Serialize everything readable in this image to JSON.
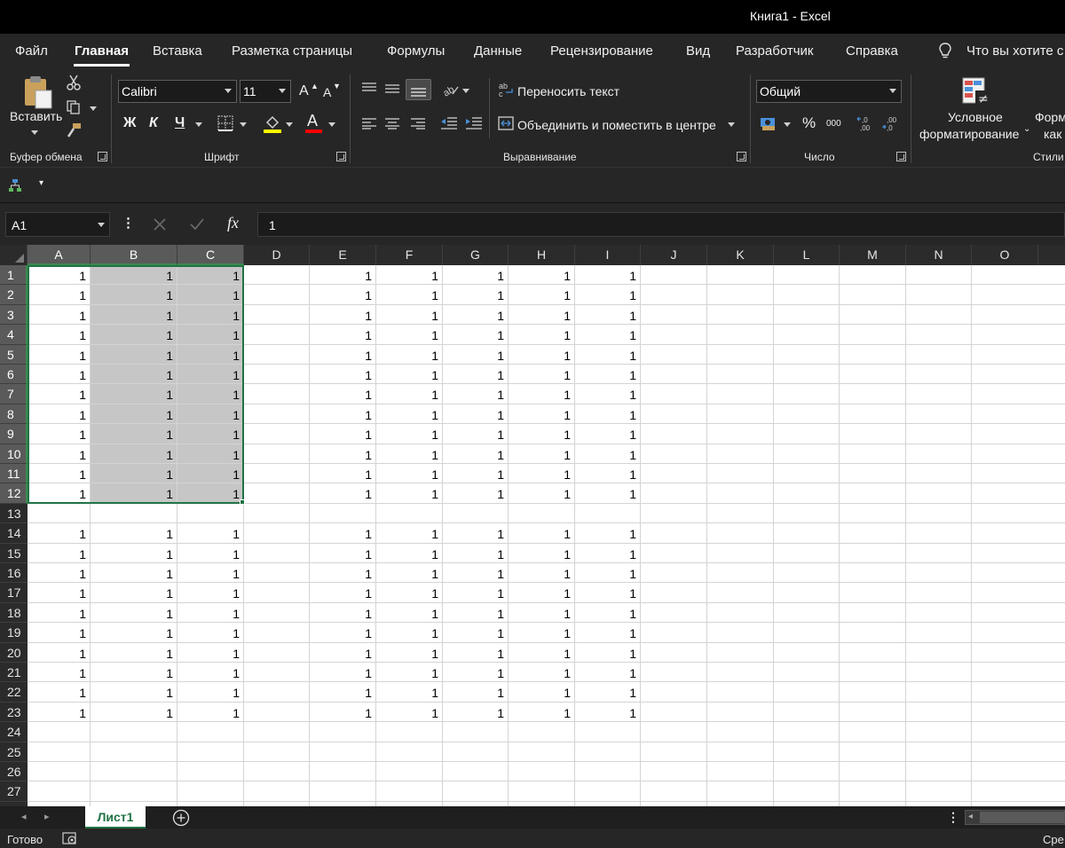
{
  "window": {
    "title": "Книга1  -  Excel"
  },
  "menu": {
    "tabs": [
      "Файл",
      "Главная",
      "Вставка",
      "Разметка страницы",
      "Формулы",
      "Данные",
      "Рецензирование",
      "Вид",
      "Разработчик",
      "Справка"
    ],
    "active_tab": "Главная",
    "tell_me": "Что вы хотите с"
  },
  "ribbon": {
    "clipboard": {
      "paste_label": "Вставить",
      "group_label": "Буфер обмена"
    },
    "font": {
      "font_name": "Calibri",
      "font_size": "11",
      "bold": "Ж",
      "italic": "К",
      "underline": "Ч",
      "font_color_glyph": "A",
      "grow_glyph": "A",
      "shrink_glyph": "A",
      "group_label": "Шрифт",
      "highlight_color": "#ffff00",
      "font_color": "#ff0000"
    },
    "alignment": {
      "wrap_text": "Переносить текст",
      "merge_center": "Объединить и поместить в центре",
      "group_label": "Выравнивание"
    },
    "number": {
      "format": "Общий",
      "percent": "%",
      "thousands": "000",
      "group_label": "Число"
    },
    "styles": {
      "conditional_line1": "Условное",
      "conditional_line2": "форматирование",
      "format_table_line1": "Форм",
      "format_table_line2": "как т",
      "group_label": "Стили"
    }
  },
  "formula_bar": {
    "name_box": "A1",
    "fx": "fx",
    "content": "1"
  },
  "grid": {
    "columns": [
      "A",
      "B",
      "C",
      "D",
      "E",
      "F",
      "G",
      "H",
      "I",
      "J",
      "K",
      "L",
      "M",
      "N",
      "O"
    ],
    "rows": [
      "1",
      "2",
      "3",
      "4",
      "5",
      "6",
      "7",
      "8",
      "9",
      "10",
      "11",
      "12",
      "13",
      "14",
      "15",
      "16",
      "17",
      "18",
      "19",
      "20",
      "21",
      "22",
      "23",
      "24",
      "25",
      "26",
      "27"
    ],
    "selected_columns": [
      "A",
      "B",
      "C"
    ],
    "selected_rows": [
      "1",
      "2",
      "3",
      "4",
      "5",
      "6",
      "7",
      "8",
      "9",
      "10",
      "11",
      "12"
    ],
    "selection_range": "A1:C12",
    "cell_value": "1",
    "rows_with_values": [
      "1",
      "2",
      "3",
      "4",
      "5",
      "6",
      "7",
      "8",
      "9",
      "10",
      "11",
      "12",
      "14",
      "15",
      "16",
      "17",
      "18",
      "19",
      "20",
      "21",
      "22",
      "23"
    ],
    "columns_with_values": [
      "A",
      "B",
      "C",
      "E",
      "F",
      "G",
      "H",
      "I"
    ]
  },
  "sheet_tabs": {
    "tabs": [
      "Лист1"
    ],
    "active": "Лист1"
  },
  "status": {
    "ready": "Готово",
    "right": "Сре"
  },
  "colors": {
    "accent": "#217346",
    "selection_fill": "#c6c6c6",
    "chrome": "#262626"
  }
}
